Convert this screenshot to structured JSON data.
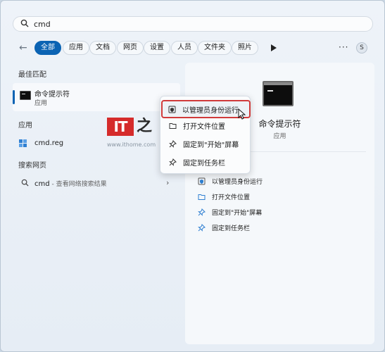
{
  "search": {
    "value": "cmd"
  },
  "filters": {
    "chips": [
      "全部",
      "应用",
      "文档",
      "网页",
      "设置",
      "人员",
      "文件夹",
      "照片"
    ],
    "active_index": 0,
    "avatar_initial": "S"
  },
  "left": {
    "best_match_title": "最佳匹配",
    "best_match": {
      "name": "命令提示符",
      "type": "应用"
    },
    "apps_title": "应用",
    "app_item": "cmd.reg",
    "web_title": "搜索网页",
    "web_item": {
      "query": "cmd",
      "hint": " - 查看网络搜索结果"
    }
  },
  "watermark": {
    "logo_text": "IT",
    "url": "www.ithome.com"
  },
  "right": {
    "title": "命令提示符",
    "subtitle": "应用",
    "actions": [
      "以管理员身份运行",
      "打开文件位置",
      "固定到\"开始\"屏幕",
      "固定到任务栏"
    ]
  },
  "context_menu": {
    "items": [
      "以管理员身份运行",
      "打开文件位置",
      "固定到\"开始\"屏幕",
      "固定到任务栏"
    ]
  },
  "colors": {
    "accent": "#0b63b3",
    "highlight_border": "#d03b3b"
  }
}
